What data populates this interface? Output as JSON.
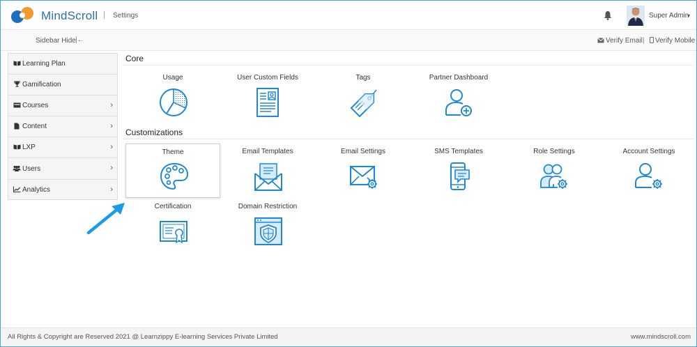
{
  "header": {
    "brand": "MindScroll",
    "separator": "|",
    "breadcrumb": "Settings",
    "user_name": "Super Admin",
    "caret": "▾"
  },
  "subbar": {
    "sidebar_hide": "Sidebar Hide",
    "sidebar_hide_icon": "|←",
    "verify_email": "Verify Email",
    "separator": "|",
    "verify_mobile": "Verify Mobile"
  },
  "sidebar": {
    "items": [
      {
        "label": "Learning Plan",
        "icon": "book-icon",
        "glyph": "📖",
        "has_chevron": false
      },
      {
        "label": "Gamification",
        "icon": "trophy-icon",
        "glyph": "🏆",
        "has_chevron": false
      },
      {
        "label": "Courses",
        "icon": "card-icon",
        "glyph": "▬",
        "has_chevron": true
      },
      {
        "label": "Content",
        "icon": "file-icon",
        "glyph": "▮",
        "has_chevron": true
      },
      {
        "label": "LXP",
        "icon": "book-icon",
        "glyph": "📖",
        "has_chevron": true
      },
      {
        "label": "Users",
        "icon": "users-icon",
        "glyph": "👥",
        "has_chevron": true
      },
      {
        "label": "Analytics",
        "icon": "chart-icon",
        "glyph": "📈",
        "has_chevron": true
      }
    ],
    "chevron": "›"
  },
  "core": {
    "title": "Core",
    "tiles": [
      {
        "label": "Usage",
        "icon": "pie-chart-icon"
      },
      {
        "label": "User Custom Fields",
        "icon": "profile-form-icon"
      },
      {
        "label": "Tags",
        "icon": "tag-icon"
      },
      {
        "label": "Partner Dashboard",
        "icon": "user-add-icon"
      }
    ]
  },
  "customizations": {
    "title": "Customizations",
    "tiles": [
      {
        "label": "Theme",
        "icon": "palette-icon",
        "active": true
      },
      {
        "label": "Email Templates",
        "icon": "email-template-icon"
      },
      {
        "label": "Email Settings",
        "icon": "email-settings-icon"
      },
      {
        "label": "SMS Templates",
        "icon": "sms-template-icon"
      },
      {
        "label": "Role Settings",
        "icon": "role-settings-icon"
      },
      {
        "label": "Account Settings",
        "icon": "account-settings-icon"
      },
      {
        "label": "Certification",
        "icon": "certificate-icon"
      },
      {
        "label": "Domain Restriction",
        "icon": "domain-shield-icon"
      }
    ]
  },
  "footer": {
    "copyright": "All Rights & Copyright are Reserved 2021 @ Learnzippy E-learning Services Private Limited",
    "website": "www.mindscroll.com"
  },
  "colors": {
    "accent": "#1e88d6",
    "brand": "#2f6fa8",
    "logo_orange": "#f29a2e"
  }
}
